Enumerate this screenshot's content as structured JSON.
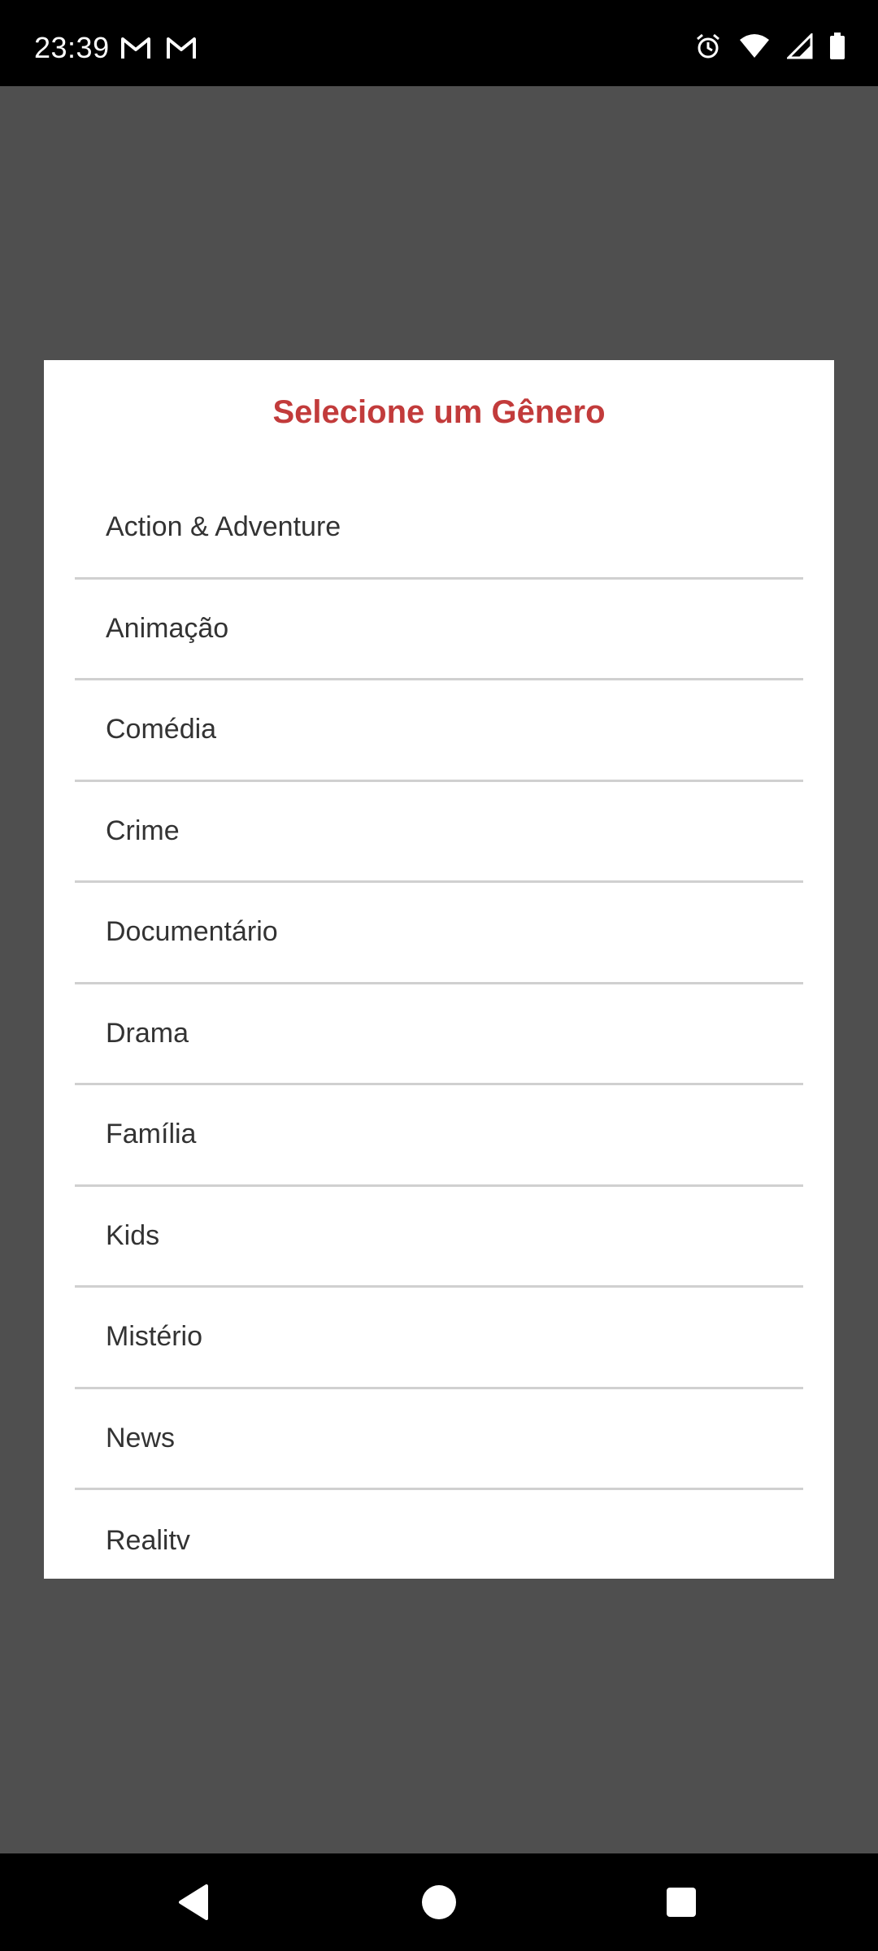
{
  "status_bar": {
    "time": "23:39",
    "left_icons": [
      "gmail-icon",
      "gmail-icon"
    ],
    "right_icons": [
      "alarm-icon",
      "wifi-icon",
      "signal-icon",
      "battery-icon"
    ]
  },
  "dialog": {
    "title": "Selecione um Gênero",
    "title_color": "#c23b3b",
    "genres": [
      "Action & Adventure",
      "Animação",
      "Comédia",
      "Crime",
      "Documentário",
      "Drama",
      "Família",
      "Kids",
      "Mistério",
      "News",
      "Realitv"
    ]
  },
  "nav_bar": {
    "buttons": [
      "back-icon",
      "home-icon",
      "recents-icon"
    ]
  }
}
